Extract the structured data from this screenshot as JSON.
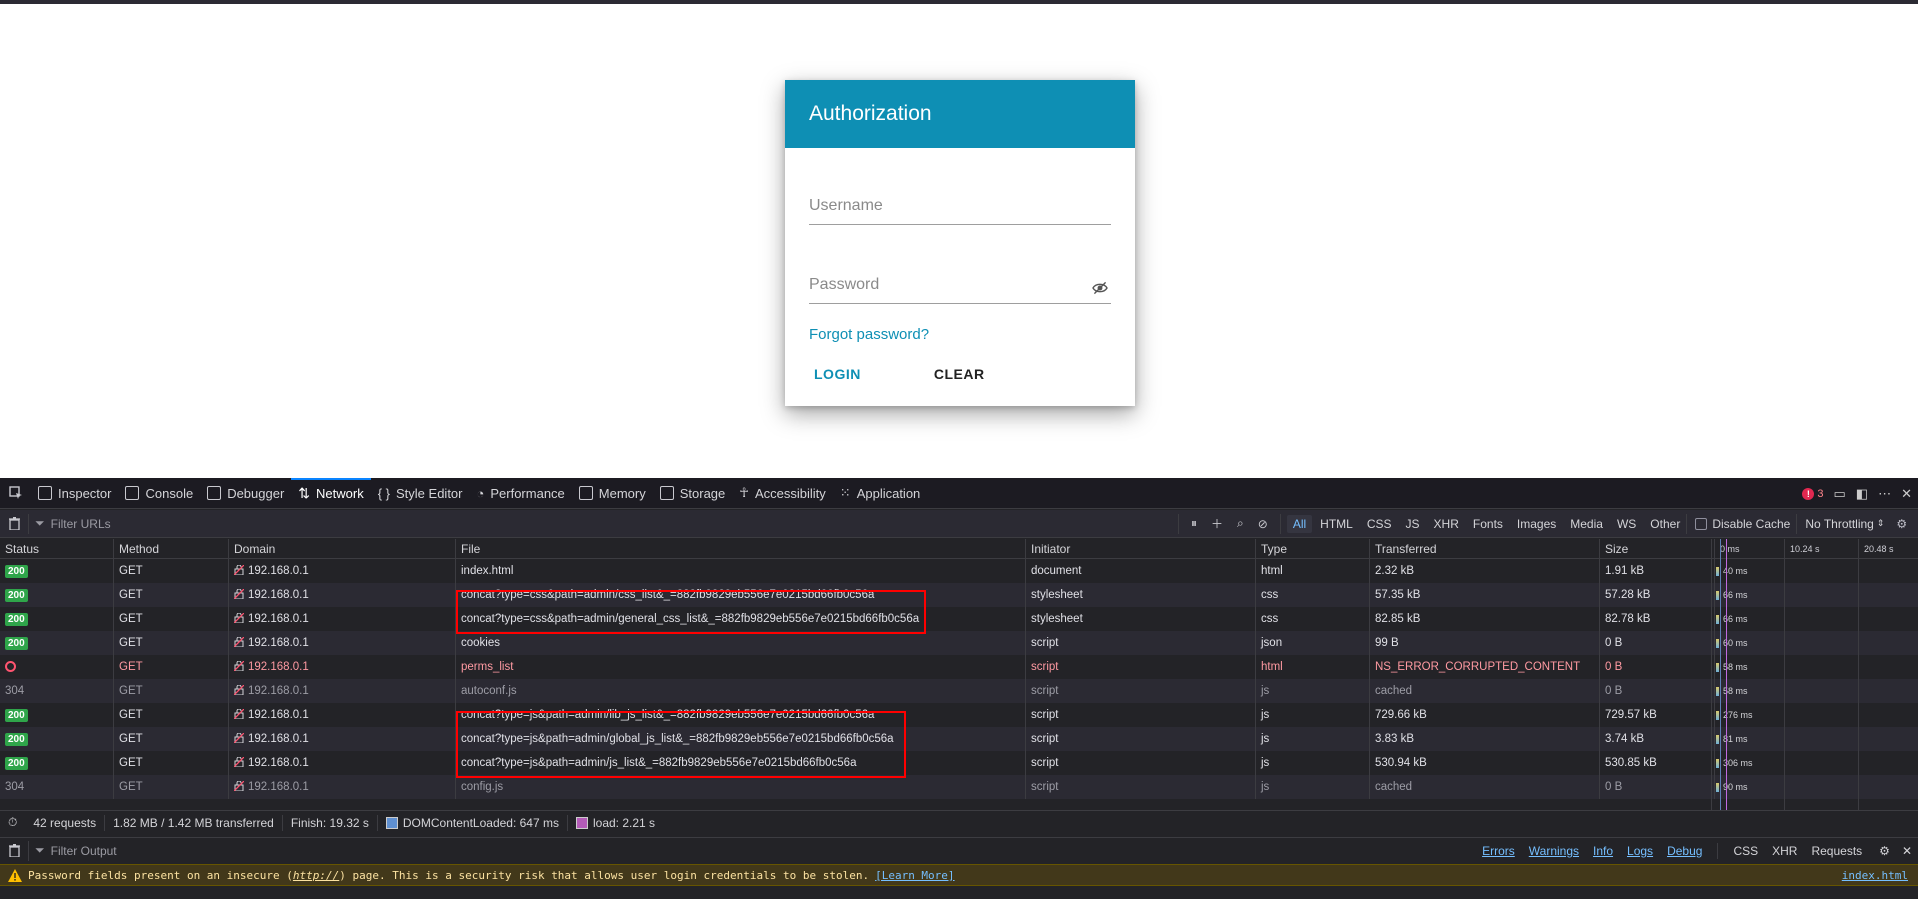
{
  "auth": {
    "title": "Authorization",
    "username_placeholder": "Username",
    "password_placeholder": "Password",
    "forgot_label": "Forgot password?",
    "login_label": "LOGIN",
    "clear_label": "CLEAR"
  },
  "devtools": {
    "tabs": [
      "Inspector",
      "Console",
      "Debugger",
      "Network",
      "Style Editor",
      "Performance",
      "Memory",
      "Storage",
      "Accessibility",
      "Application"
    ],
    "active_tab": "Network",
    "error_count": "3"
  },
  "network": {
    "filter_placeholder": "Filter URLs",
    "type_filters": [
      "All",
      "HTML",
      "CSS",
      "JS",
      "XHR",
      "Fonts",
      "Images",
      "Media",
      "WS",
      "Other"
    ],
    "active_filter": "All",
    "disable_cache_label": "Disable Cache",
    "throttling_label": "No Throttling",
    "columns": [
      "Status",
      "Method",
      "Domain",
      "File",
      "Initiator",
      "Type",
      "Transferred",
      "Size"
    ],
    "waterfall_ticks": [
      "0 ms",
      "10.24 s",
      "20.48 s"
    ],
    "rows": [
      {
        "status": "200",
        "method": "GET",
        "domain": "192.168.0.1",
        "file": "index.html",
        "initiator": "document",
        "type": "html",
        "transferred": "2.32 kB",
        "size": "1.91 kB",
        "time": "40 ms"
      },
      {
        "status": "200",
        "method": "GET",
        "domain": "192.168.0.1",
        "file": "concat?type=css&path=admin/css_list&_=882fb9829eb556e7e0215bd66fb0c56a",
        "initiator": "stylesheet",
        "type": "css",
        "transferred": "57.35 kB",
        "size": "57.28 kB",
        "time": "66 ms"
      },
      {
        "status": "200",
        "method": "GET",
        "domain": "192.168.0.1",
        "file": "concat?type=css&path=admin/general_css_list&_=882fb9829eb556e7e0215bd66fb0c56a",
        "initiator": "stylesheet",
        "type": "css",
        "transferred": "82.85 kB",
        "size": "82.78 kB",
        "time": "66 ms"
      },
      {
        "status": "200",
        "method": "GET",
        "domain": "192.168.0.1",
        "file": "cookies",
        "initiator": "script",
        "type": "json",
        "transferred": "99 B",
        "size": "0 B",
        "time": "60 ms"
      },
      {
        "status": "blocked",
        "method": "GET",
        "domain": "192.168.0.1",
        "file": "perms_list",
        "initiator": "script",
        "type": "html",
        "transferred": "NS_ERROR_CORRUPTED_CONTENT",
        "size": "0 B",
        "time": "58 ms"
      },
      {
        "status": "304",
        "method": "GET",
        "domain": "192.168.0.1",
        "file": "autoconf.js",
        "initiator": "script",
        "type": "js",
        "transferred": "cached",
        "size": "0 B",
        "time": "58 ms"
      },
      {
        "status": "200",
        "method": "GET",
        "domain": "192.168.0.1",
        "file": "concat?type=js&path=admin/lib_js_list&_=882fb9829eb556e7e0215bd66fb0c56a",
        "initiator": "script",
        "type": "js",
        "transferred": "729.66 kB",
        "size": "729.57 kB",
        "time": "276 ms"
      },
      {
        "status": "200",
        "method": "GET",
        "domain": "192.168.0.1",
        "file": "concat?type=js&path=admin/global_js_list&_=882fb9829eb556e7e0215bd66fb0c56a",
        "initiator": "script",
        "type": "js",
        "transferred": "3.83 kB",
        "size": "3.74 kB",
        "time": "81 ms"
      },
      {
        "status": "200",
        "method": "GET",
        "domain": "192.168.0.1",
        "file": "concat?type=js&path=admin/js_list&_=882fb9829eb556e7e0215bd66fb0c56a",
        "initiator": "script",
        "type": "js",
        "transferred": "530.94 kB",
        "size": "530.85 kB",
        "time": "306 ms"
      },
      {
        "status": "304",
        "method": "GET",
        "domain": "192.168.0.1",
        "file": "config.js",
        "initiator": "script",
        "type": "js",
        "transferred": "cached",
        "size": "0 B",
        "time": "90 ms"
      }
    ],
    "summary": {
      "requests": "42 requests",
      "transferred": "1.82 MB / 1.42 MB transferred",
      "finish": "Finish: 19.32 s",
      "dom_loaded": "DOMContentLoaded: 647 ms",
      "load": "load: 2.21 s"
    }
  },
  "console": {
    "filter_placeholder": "Filter Output",
    "filters": [
      "Errors",
      "Warnings",
      "Info",
      "Logs",
      "Debug",
      "CSS",
      "XHR",
      "Requests"
    ],
    "message_prefix": "Password fields present on an insecure (",
    "message_url": "http://",
    "message_suffix": ") page. This is a security risk that allows user login credentials to be stolen.",
    "learn_more": "[Learn More]",
    "source": "index.html"
  },
  "colors": {
    "auth_header": "#0e8fb4",
    "status_ok": "#2fa54a",
    "highlight": "#ff0000",
    "warning_bg": "#42381a"
  }
}
